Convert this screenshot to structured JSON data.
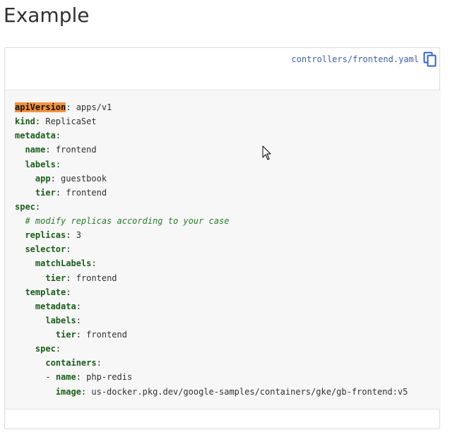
{
  "page": {
    "title": "Example"
  },
  "code_block": {
    "file_link": "controllers/frontend.yaml",
    "copy_icon": "copy-icon",
    "lines": [
      {
        "indent": "",
        "key": "apiVersion",
        "sep": ": ",
        "value": "apps/v1",
        "highlight": true
      },
      {
        "indent": "",
        "key": "kind",
        "sep": ": ",
        "value": "ReplicaSet"
      },
      {
        "indent": "",
        "key": "metadata",
        "sep": ":",
        "value": ""
      },
      {
        "indent": "  ",
        "key": "name",
        "sep": ": ",
        "value": "frontend"
      },
      {
        "indent": "  ",
        "key": "labels",
        "sep": ":",
        "value": ""
      },
      {
        "indent": "    ",
        "key": "app",
        "sep": ": ",
        "value": "guestbook"
      },
      {
        "indent": "    ",
        "key": "tier",
        "sep": ": ",
        "value": "frontend"
      },
      {
        "indent": "",
        "key": "spec",
        "sep": ":",
        "value": ""
      },
      {
        "indent": "  ",
        "comment": "# modify replicas according to your case"
      },
      {
        "indent": "  ",
        "key": "replicas",
        "sep": ": ",
        "value": "3",
        "numeric": true
      },
      {
        "indent": "  ",
        "key": "selector",
        "sep": ":",
        "value": ""
      },
      {
        "indent": "    ",
        "key": "matchLabels",
        "sep": ":",
        "value": ""
      },
      {
        "indent": "      ",
        "key": "tier",
        "sep": ": ",
        "value": "frontend"
      },
      {
        "indent": "  ",
        "key": "template",
        "sep": ":",
        "value": ""
      },
      {
        "indent": "    ",
        "key": "metadata",
        "sep": ":",
        "value": ""
      },
      {
        "indent": "      ",
        "key": "labels",
        "sep": ":",
        "value": ""
      },
      {
        "indent": "        ",
        "key": "tier",
        "sep": ": ",
        "value": "frontend"
      },
      {
        "indent": "    ",
        "key": "spec",
        "sep": ":",
        "value": ""
      },
      {
        "indent": "      ",
        "key": "containers",
        "sep": ":",
        "value": ""
      },
      {
        "indent": "      ",
        "dash": "- ",
        "key": "name",
        "sep": ": ",
        "value": "php-redis"
      },
      {
        "indent": "        ",
        "key": "image",
        "sep": ": ",
        "value": "us-docker.pkg.dev/google-samples/containers/gke/gb-frontend:v5"
      }
    ]
  },
  "colors": {
    "key": "#1a5e1a",
    "highlight": "#f5923e",
    "comment": "#2a7b2a",
    "link": "#3a5fb0",
    "code_background": "#f7f7f7"
  }
}
